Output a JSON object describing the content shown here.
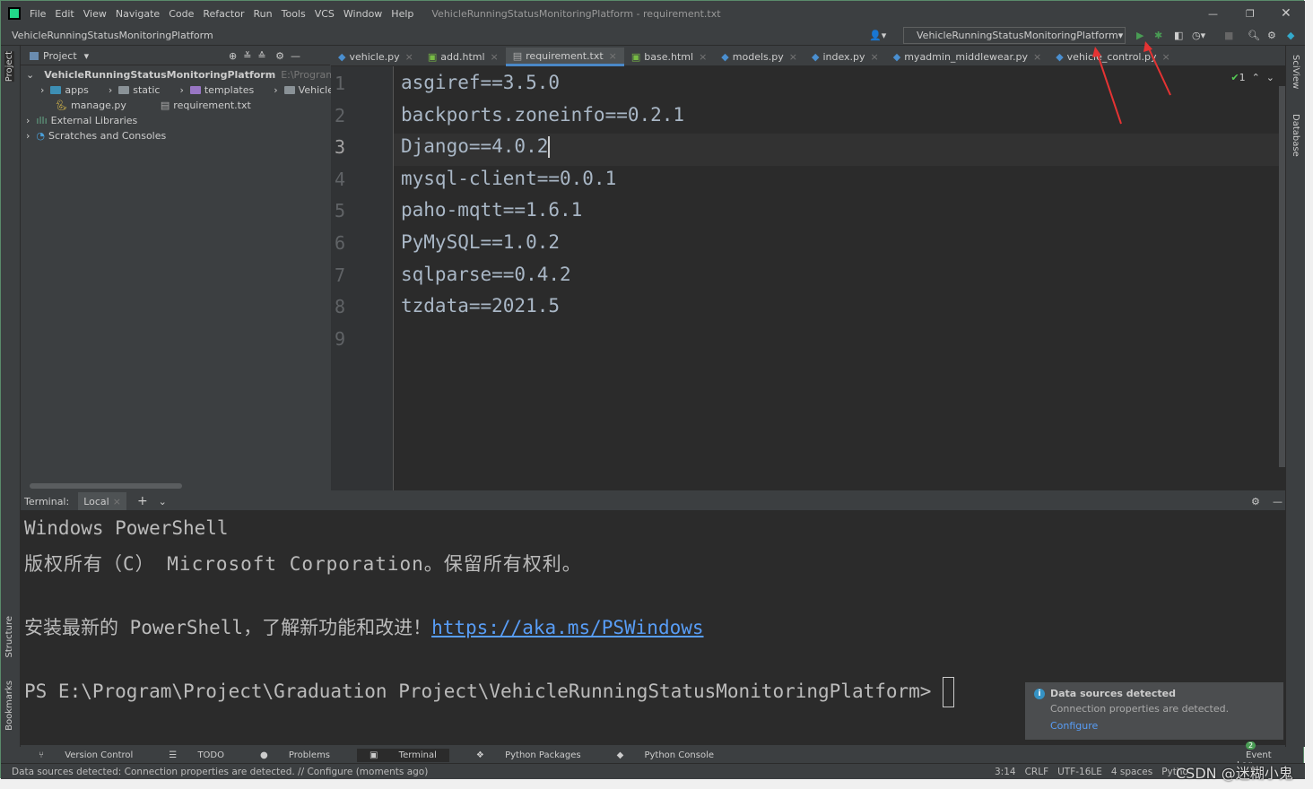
{
  "window": {
    "title": "VehicleRunningStatusMonitoringPlatform - requirement.txt"
  },
  "menu": [
    "File",
    "Edit",
    "View",
    "Navigate",
    "Code",
    "Refactor",
    "Run",
    "Tools",
    "VCS",
    "Window",
    "Help"
  ],
  "navbar": {
    "breadcrumb": "VehicleRunningStatusMonitoringPlatform",
    "run_config": "VehicleRunningStatusMonitoringPlatform"
  },
  "project": {
    "header": "Project",
    "root": "VehicleRunningStatusMonitoringPlatform",
    "root_path": "E:\\Program\\Projec",
    "items": [
      {
        "label": "apps",
        "color": "#3d8fb5"
      },
      {
        "label": "static",
        "color": "#8a9297"
      },
      {
        "label": "templates",
        "color": "#9876c4"
      },
      {
        "label": "VehicleRunningStatusMonitoringPlatform",
        "color": "#8a9297"
      }
    ],
    "files": [
      "manage.py",
      "requirement.txt"
    ],
    "external": "External Libraries",
    "scratches": "Scratches and Consoles"
  },
  "tabs": [
    "vehicle.py",
    "add.html",
    "requirement.txt",
    "base.html",
    "models.py",
    "index.py",
    "myadmin_middlewear.py",
    "vehicle_control.py"
  ],
  "active_tab": "requirement.txt",
  "editor": {
    "lines": [
      "asgiref==3.5.0",
      "backports.zoneinfo==0.2.1",
      "Django==4.0.2",
      "mysql-client==0.0.1",
      "paho-mqtt==1.6.1",
      "PyMySQL==1.0.2",
      "sqlparse==0.4.2",
      "tzdata==2021.5",
      ""
    ],
    "current_line": 3,
    "inspections": "1"
  },
  "side": {
    "left_top": "Project",
    "left_structure": "Structure",
    "left_bookmarks": "Bookmarks",
    "right_sciview": "SciView",
    "right_database": "Database"
  },
  "terminal": {
    "label": "Terminal:",
    "tab": "Local",
    "lines": [
      "Windows PowerShell",
      "版权所有（C） Microsoft Corporation。保留所有权利。",
      "",
      "安装最新的 PowerShell，了解新功能和改进！"
    ],
    "link": "https://aka.ms/PSWindows",
    "prompt": "PS E:\\Program\\Project\\Graduation Project\\VehicleRunningStatusMonitoringPlatform> "
  },
  "notification": {
    "title": "Data sources detected",
    "body": "Connection properties are detected.",
    "action": "Configure"
  },
  "toolwindows": [
    "Version Control",
    "TODO",
    "Problems",
    "Terminal",
    "Python Packages",
    "Python Console"
  ],
  "event_log": {
    "count": "2",
    "label": "Event Log"
  },
  "status": {
    "message": "Data sources detected: Connection properties are detected. // Configure (moments ago)",
    "position": "3:14",
    "line_sep": "CRLF",
    "encoding": "UTF-16LE",
    "indent": "4 spaces",
    "interpreter": "Pytho"
  },
  "watermark": "CSDN @迷糊小鬼"
}
